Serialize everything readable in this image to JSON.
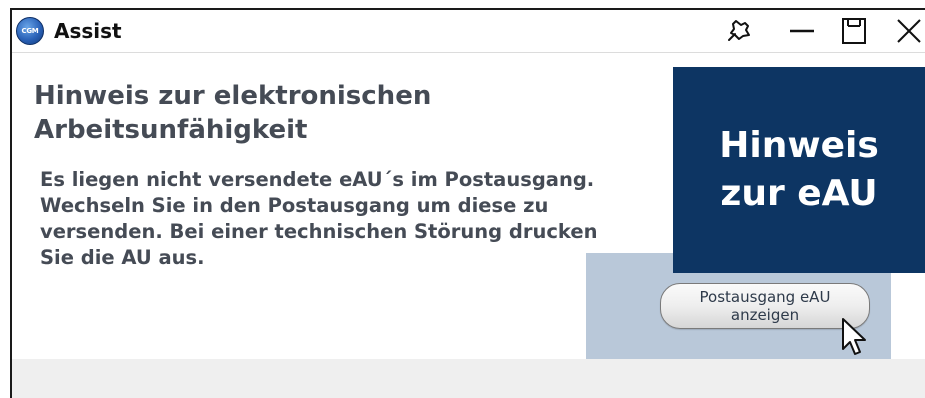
{
  "window": {
    "title": "Assist",
    "logo_text": "CGM",
    "controls": [
      "pin-icon",
      "minimize-icon",
      "maximize-icon",
      "close-icon"
    ]
  },
  "content": {
    "heading": "Hinweis zur elektronischen Arbeitsunfähigkeit",
    "message": "Es liegen nicht versendete eAU´s im Postausgang. Wechseln Sie in den Postausgang um diese zu versenden. Bei einer technischen Störung drucken Sie die AU aus.",
    "banner": "Hinweis zur eAU",
    "button_label": "Postausgang eAU anzeigen"
  },
  "colors": {
    "banner_bg": "#0d3563",
    "panel_bg": "#b9c8d9",
    "text": "#454b55"
  }
}
